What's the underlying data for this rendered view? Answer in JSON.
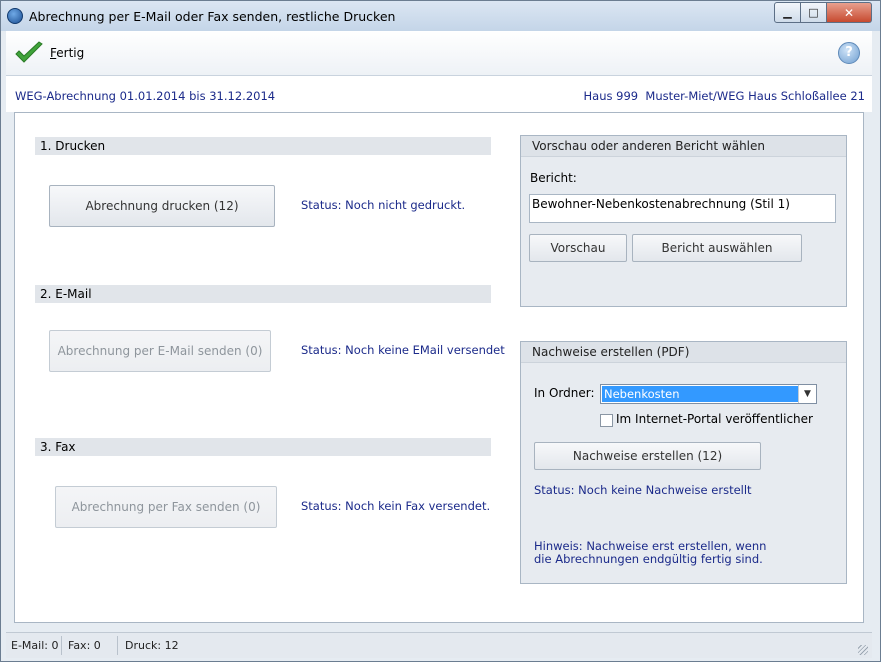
{
  "window": {
    "title": "Abrechnung per E-Mail oder Fax senden, restliche Drucken",
    "minimize": "▁",
    "maximize": "□",
    "close": "✕"
  },
  "toolbar": {
    "fertig_label_u": "F",
    "fertig_label_rest": "ertig",
    "help_label": "?"
  },
  "info": {
    "left": "WEG-Abrechnung 01.01.2014 bis 31.12.2014",
    "right": "Haus 999  Muster-Miet/WEG Haus Schloßallee 21"
  },
  "print": {
    "heading": "1. Drucken",
    "button": "Abrechnung drucken (12)",
    "status": "Status: Noch nicht gedruckt."
  },
  "email": {
    "heading": "2. E-Mail",
    "button": "Abrechnung per E-Mail senden (0)",
    "status": "Status: Noch keine EMail versendet"
  },
  "fax": {
    "heading": "3. Fax",
    "button": "Abrechnung per Fax senden (0)",
    "status": "Status: Noch kein Fax versendet."
  },
  "preview": {
    "title": "Vorschau oder anderen Bericht wählen",
    "report_label": "Bericht:",
    "report_value": "Bewohner-Nebenkostenabrechnung (Stil 1)",
    "preview_button": "Vorschau",
    "select_button": "Bericht auswählen"
  },
  "proofs": {
    "title": "Nachweise erstellen (PDF)",
    "folder_label": "In Ordner:",
    "folder_value": "Nebenkosten",
    "portal_label": "Im Internet-Portal veröffentlicher",
    "create_button": "Nachweise erstellen (12)",
    "status": "Status: Noch keine Nachweise erstellt",
    "hint_line1": "Hinweis: Nachweise erst erstellen, wenn",
    "hint_line2": "die Abrechnungen endgültig fertig sind."
  },
  "statusbar": {
    "email": "E-Mail: 0",
    "fax": "Fax: 0",
    "print": "Druck: 12"
  },
  "colors": {
    "accent_text": "#1b2a8a",
    "selection": "#3399ff"
  }
}
